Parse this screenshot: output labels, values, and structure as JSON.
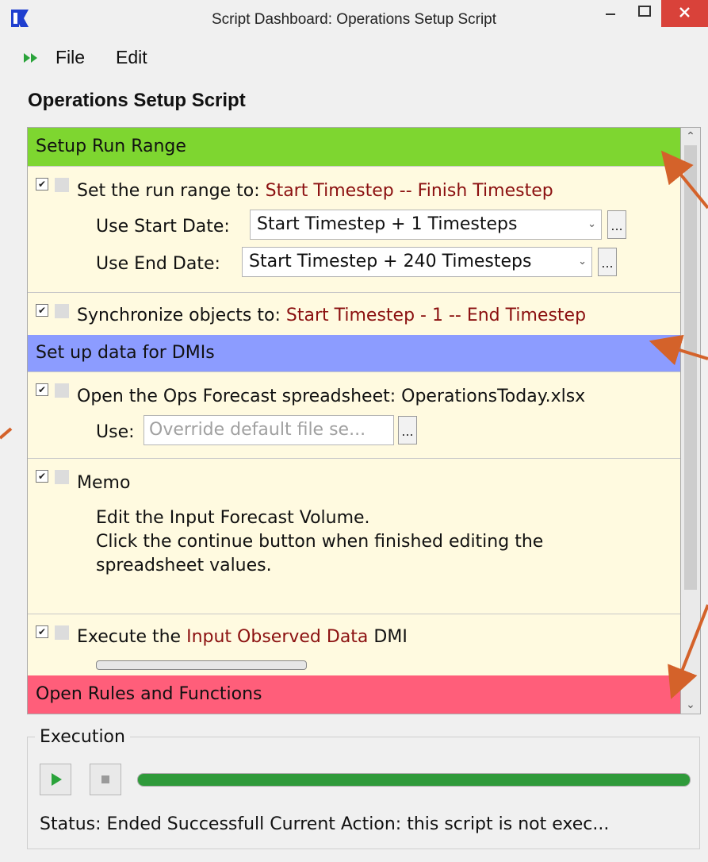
{
  "window": {
    "title": "Script Dashboard: Operations Setup Script",
    "app_icon": "riverware-logo-icon",
    "controls": [
      "minimize-icon",
      "maximize-icon",
      "close-icon"
    ]
  },
  "menu": {
    "icon": "run-arrows-icon",
    "items": [
      "File",
      "Edit"
    ]
  },
  "script_title": "Operations Setup Script",
  "sections": {
    "setup_run_range": "Setup Run Range",
    "setup_data": "Set up data for DMIs",
    "open_rules": "Open Rules and Functions"
  },
  "actions": {
    "run_range": {
      "prefix": "Set the run range to: ",
      "start": "Start Timestep",
      "sep": " -- ",
      "finish": "Finish Timestep",
      "start_label": "Use Start Date:",
      "start_value": "Start Timestep + 1 Timesteps",
      "end_label": "Use End Date:",
      "end_value": "Start Timestep + 240 Timesteps",
      "browse_label": "..."
    },
    "sync": {
      "prefix": "Synchronize objects to: ",
      "range": "Start Timestep - 1 -- End Timestep"
    },
    "open_spreadsheet": {
      "text": "Open the Ops Forecast spreadsheet: OperationsToday.xlsx",
      "use_label": "Use:",
      "placeholder": "Override default file se...",
      "browse_label": "..."
    },
    "memo": {
      "title": "Memo",
      "lines": [
        "Edit the Input Forecast Volume.",
        "Click the continue button when finished editing the",
        "spreadsheet values."
      ]
    },
    "execute_dmi": {
      "prefix": "Execute the ",
      "dmi_name": "Input Observed Data",
      "suffix": " DMI"
    }
  },
  "execution": {
    "label": "Execution",
    "progress": 1.0,
    "status": "Status: Ended Successfull Current Action: this script is not exec..."
  },
  "colors": {
    "section_green": "#7ed630",
    "section_blue": "#8c9cff",
    "section_red": "#ff5e7a",
    "action_bg": "#fffae0",
    "highlight_text": "#8b1010",
    "progress_green": "#2f9a3a",
    "annotation_arrow": "#d4622a"
  }
}
